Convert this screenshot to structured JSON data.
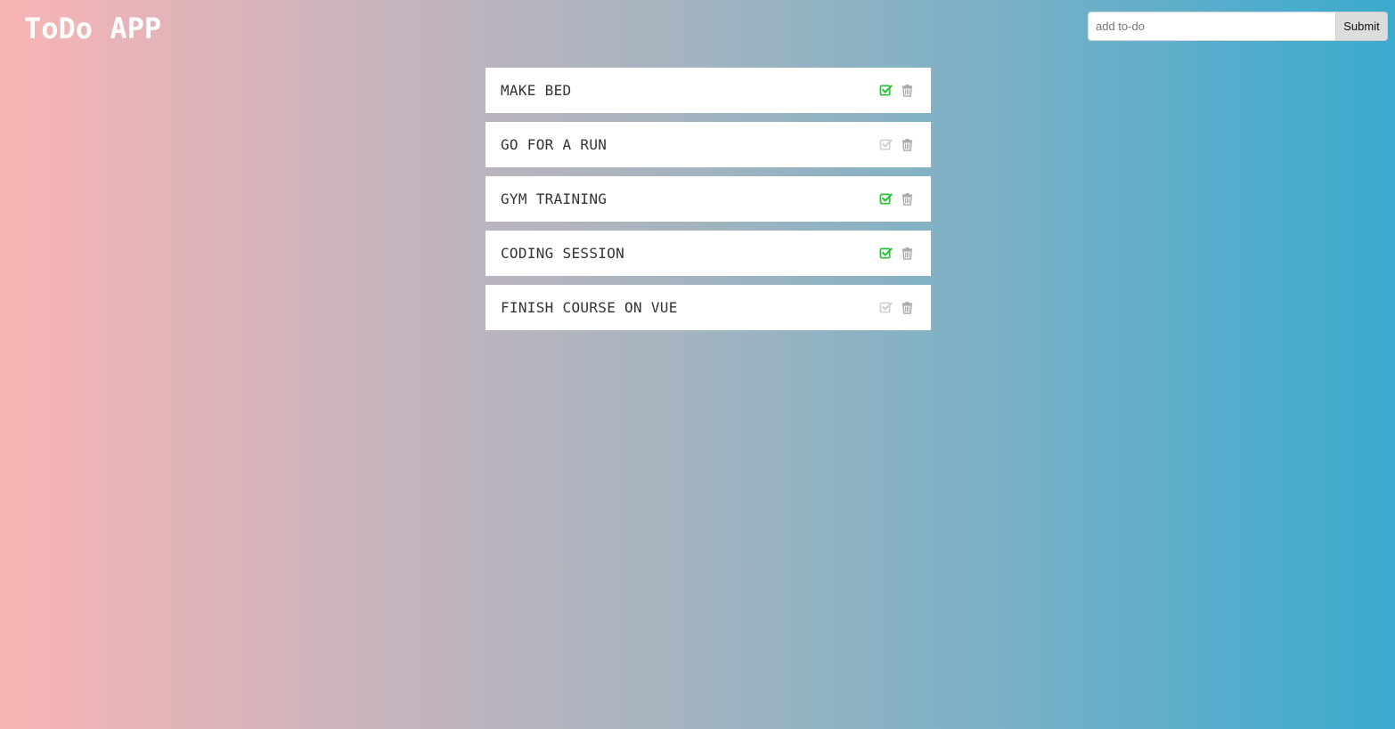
{
  "header": {
    "title": "ToDo APP"
  },
  "add_form": {
    "placeholder": "add to-do",
    "value": "",
    "submit_label": "Submit"
  },
  "colors": {
    "gradient_start": "#f8b4b4",
    "gradient_end": "#3aaace",
    "done_check": "#2bbf3a",
    "undone_check": "#d2d2d2",
    "trash": "#a9a9a9"
  },
  "todos": [
    {
      "text": "MAKE BED",
      "done": true
    },
    {
      "text": "GO FOR A RUN",
      "done": false
    },
    {
      "text": "GYM TRAINING",
      "done": true
    },
    {
      "text": "CODING SESSION",
      "done": true
    },
    {
      "text": "FINISH COURSE ON VUE",
      "done": false
    }
  ],
  "icons": {
    "check": "check-square-icon",
    "delete": "trash-icon"
  }
}
